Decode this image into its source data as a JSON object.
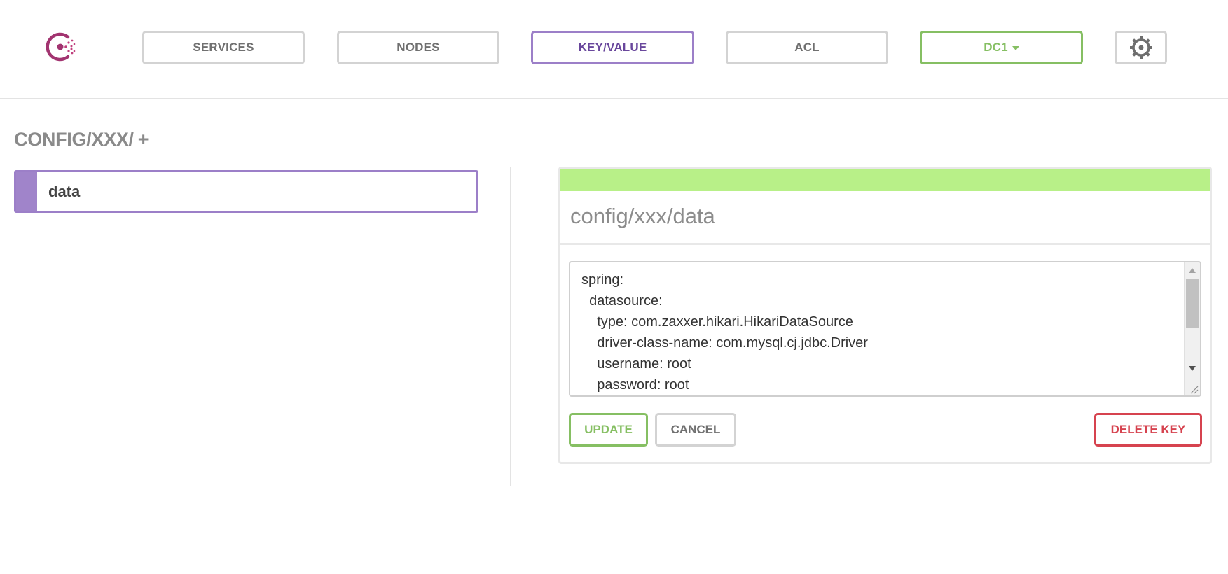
{
  "nav": {
    "services": "SERVICES",
    "nodes": "NODES",
    "keyvalue": "KEY/VALUE",
    "acl": "ACL",
    "datacenter": "DC1"
  },
  "breadcrumb": {
    "path": "CONFIG/XXX/",
    "add": "+"
  },
  "keys": [
    {
      "label": "data"
    }
  ],
  "editor": {
    "key_path": "config/xxx/data",
    "value": "spring:\n  datasource:\n    type: com.zaxxer.hikari.HikariDataSource\n    driver-class-name: com.mysql.cj.jdbc.Driver\n    username: root\n    password: root",
    "update_label": "UPDATE",
    "cancel_label": "CANCEL",
    "delete_label": "DELETE KEY"
  },
  "colors": {
    "accent_purple": "#9c7fc8",
    "accent_green": "#86bf63",
    "status_green": "#b8f088",
    "danger_red": "#d6434f",
    "logo_magenta": "#a23470"
  },
  "icons": {
    "logo": "consul-logo-icon",
    "settings": "gear-icon"
  }
}
